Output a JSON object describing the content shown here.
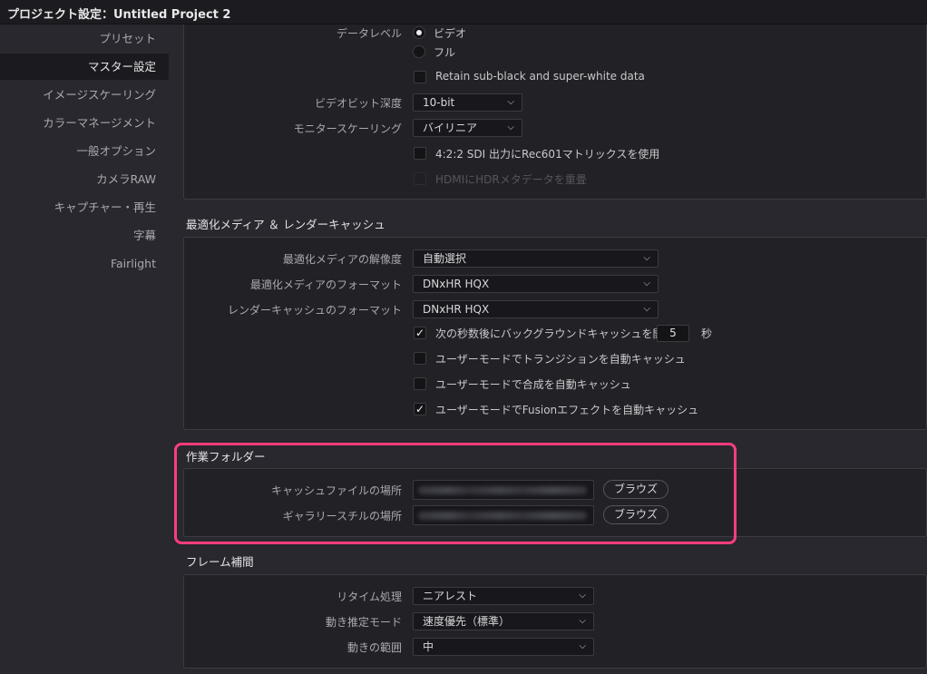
{
  "window": {
    "title": "プロジェクト設定：Untitled Project 2"
  },
  "sidebar": {
    "items": [
      {
        "label": "プリセット"
      },
      {
        "label": "マスター設定"
      },
      {
        "label": "イメージスケーリング"
      },
      {
        "label": "カラーマネージメント"
      },
      {
        "label": "一般オプション"
      },
      {
        "label": "カメラRAW"
      },
      {
        "label": "キャプチャー・再生"
      },
      {
        "label": "字幕"
      },
      {
        "label": "Fairlight"
      }
    ]
  },
  "video": {
    "data_level_label": "データレベル",
    "data_level_options": [
      "ビデオ",
      "フル"
    ],
    "data_level_selected": "ビデオ",
    "retain_label": "Retain sub-black and super-white data",
    "retain_checked": false,
    "bit_depth_label": "ビデオビット深度",
    "bit_depth_value": "10-bit",
    "monitor_scaling_label": "モニタースケーリング",
    "monitor_scaling_value": "バイリニア",
    "rec601_label": "4:2:2 SDI 出力にRec601マトリックスを使用",
    "rec601_checked": false,
    "hdmi_label": "HDMIにHDRメタデータを重畳",
    "hdmi_checked": false
  },
  "optimized": {
    "title": "最適化メディア ＆ レンダーキャッシュ",
    "resolution_label": "最適化メディアの解像度",
    "resolution_value": "自動選択",
    "format_label": "最適化メディアのフォーマット",
    "format_value": "DNxHR HQX",
    "render_format_label": "レンダーキャッシュのフォーマット",
    "render_format_value": "DNxHR HQX",
    "bg_cache_label": "次の秒数後にバックグラウンドキャッシュを開始",
    "bg_cache_checked": true,
    "bg_cache_seconds": "5",
    "bg_cache_unit": "秒",
    "transitions_label": "ユーザーモードでトランジションを自動キャッシュ",
    "transitions_checked": false,
    "composites_label": "ユーザーモードで合成を自動キャッシュ",
    "composites_checked": false,
    "fusion_label": "ユーザーモードでFusionエフェクトを自動キャッシュ",
    "fusion_checked": true
  },
  "working_folders": {
    "title": "作業フォルダー",
    "cache_label": "キャッシュファイルの場所",
    "gallery_label": "ギャラリースチルの場所",
    "browse_label": "ブラウズ"
  },
  "frame_interp": {
    "title": "フレーム補間",
    "retime_label": "リタイム処理",
    "retime_value": "ニアレスト",
    "motion_est_label": "動き推定モード",
    "motion_est_value": "速度優先（標準）",
    "motion_range_label": "動きの範囲",
    "motion_range_value": "中"
  },
  "colors": {
    "highlight": "#ff3d7d",
    "background": "#28282e"
  }
}
